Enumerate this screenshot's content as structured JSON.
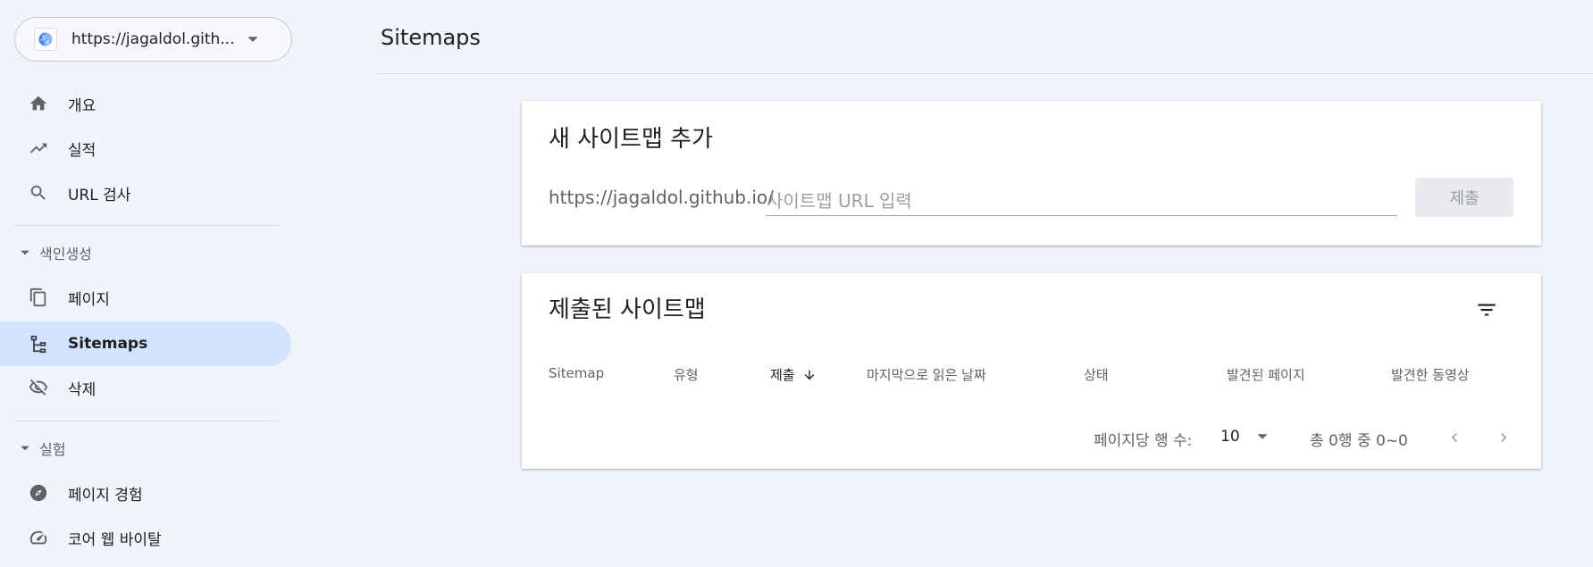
{
  "sidebar": {
    "property_url": "https://jagaldol.gith...",
    "items": [
      {
        "label": "개요"
      },
      {
        "label": "실적"
      },
      {
        "label": "URL 검사"
      }
    ],
    "sections": [
      {
        "label": "색인생성",
        "items": [
          {
            "label": "페이지"
          },
          {
            "label": "Sitemaps"
          },
          {
            "label": "삭제"
          }
        ]
      },
      {
        "label": "실험",
        "items": [
          {
            "label": "페이지 경험"
          },
          {
            "label": "코어 웹 바이탈"
          }
        ]
      }
    ]
  },
  "header": {
    "title": "Sitemaps"
  },
  "add_card": {
    "title": "새 사이트맵 추가",
    "prefix": "https://jagaldol.github.io/",
    "input_placeholder": "사이트맵 URL 입력",
    "input_value": "",
    "submit_label": "제출"
  },
  "submitted_card": {
    "title": "제출된 사이트맵",
    "columns": [
      "Sitemap",
      "유형",
      "제출",
      "마지막으로 읽은 날짜",
      "상태",
      "발견된 페이지",
      "발견한 동영상"
    ],
    "sorted_column": "제출",
    "sort_direction": "descending",
    "rows": [],
    "pagination": {
      "rows_per_page_label": "페이지당 행 수:",
      "rows_per_page": "10",
      "range_text": "총 0행 중 0~0"
    }
  },
  "icons": {
    "globe": "globe-icon",
    "dropdown": "chevron-down-icon",
    "home": "home-icon",
    "trending": "trending-up-icon",
    "search": "search-icon",
    "pages": "file-copy-icon",
    "sitemap": "sitemap-icon",
    "removals": "visibility-off-icon",
    "page_experience": "explore-icon",
    "core_web_vitals": "speed-icon",
    "filter": "filter-icon",
    "sort": "arrow-down-icon",
    "prev": "chevron-left-icon",
    "next": "chevron-right-icon"
  },
  "colors": {
    "background": "#f1f4fb",
    "active_nav": "#d3e3fd",
    "text": "#202124",
    "muted_text": "#5f6368"
  }
}
